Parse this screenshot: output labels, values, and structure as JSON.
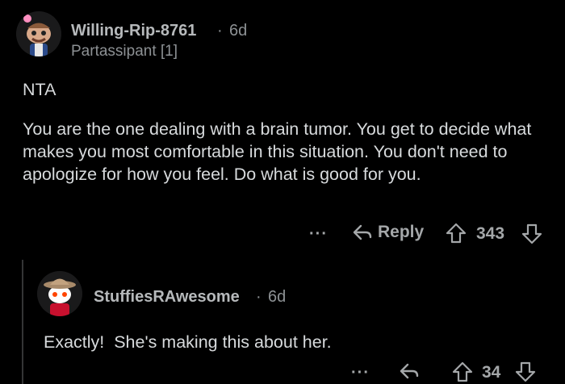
{
  "comment": {
    "username": "Willing-Rip-8761",
    "separator": "·",
    "age": "6d",
    "flair": "Partassipant [1]",
    "verdict": "NTA",
    "body": "You are the one dealing with a brain tumor. You get to decide what makes you most comfortable in this situation. You don't need to apologize for how you feel. Do what is good for you.",
    "more_label": "···",
    "reply_label": "Reply",
    "score": "343"
  },
  "reply": {
    "username": "StuffiesRAwesome",
    "separator": "·",
    "age": "6d",
    "body": "Exactly!  She's making this about her.",
    "more_label": "···",
    "score": "34"
  },
  "colors": {
    "background": "#000000",
    "text": "#d7dadc",
    "muted": "#8d9194"
  },
  "icons": [
    "snoo-avatar-icon",
    "reply-arrow-icon",
    "upvote-icon",
    "downvote-icon",
    "more-options-icon"
  ]
}
